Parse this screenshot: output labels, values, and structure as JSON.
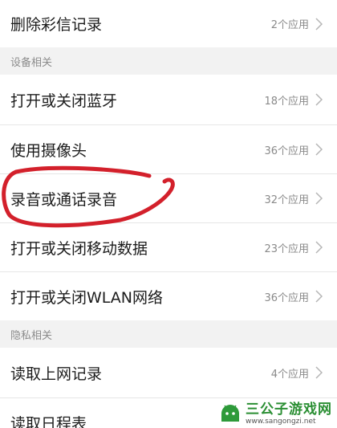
{
  "rows": [
    {
      "label": "删除彩信记录",
      "count": "2个应用"
    },
    {
      "label": "打开或关闭蓝牙",
      "count": "18个应用"
    },
    {
      "label": "使用摄像头",
      "count": "36个应用"
    },
    {
      "label": "录音或通话录音",
      "count": "32个应用"
    },
    {
      "label": "打开或关闭移动数据",
      "count": "23个应用"
    },
    {
      "label": "打开或关闭WLAN网络",
      "count": "36个应用"
    },
    {
      "label": "读取上网记录",
      "count": "4个应用"
    },
    {
      "label": "读取日程表",
      "count": ""
    }
  ],
  "sections": [
    {
      "title": "设备相关"
    },
    {
      "title": "隐私相关"
    }
  ],
  "watermark": {
    "title": "三公子游戏网",
    "url": "www.sangongzi.net"
  },
  "colors": {
    "annotation": "#d3202b",
    "section_bg": "#f2f2f2",
    "chevron": "#b5b5b5"
  },
  "icons": {
    "chevron": "chevron-right-icon",
    "watermark_logo": "android-logo-icon"
  }
}
